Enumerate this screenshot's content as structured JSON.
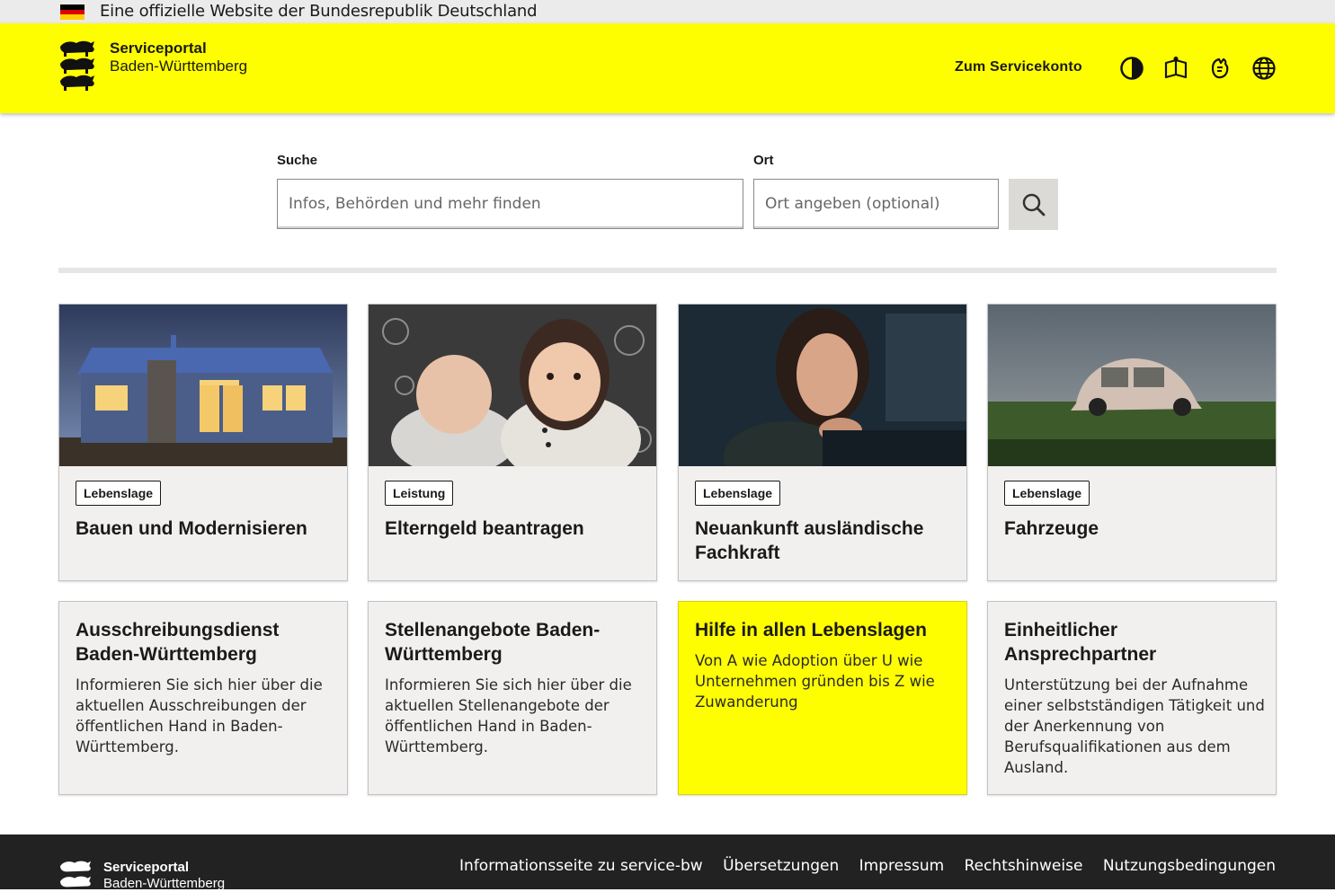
{
  "federal_bar": {
    "text": "Eine offizielle Website der Bundesrepublik Deutschland",
    "flag_colors": [
      "#000000",
      "#dd0000",
      "#ffce00"
    ]
  },
  "header": {
    "logo_line1": "Serviceportal",
    "logo_line2": "Baden-Württemberg",
    "account_link": "Zum Servicekonto",
    "icons": [
      "contrast-icon",
      "easy-language-icon",
      "sign-language-icon",
      "language-globe-icon"
    ],
    "background": "#fffe00"
  },
  "search": {
    "query_label": "Suche",
    "query_placeholder": "Infos, Behörden und mehr finden",
    "location_label": "Ort",
    "location_placeholder": "Ort angeben (optional)",
    "button_icon": "search-icon"
  },
  "cards": [
    {
      "tag": "Lebenslage",
      "title": "Bauen und Modernisieren"
    },
    {
      "tag": "Leistung",
      "title": "Elterngeld beantragen"
    },
    {
      "tag": "Lebenslage",
      "title": "Neuankunft ausländische Fachkraft"
    },
    {
      "tag": "Lebenslage",
      "title": "Fahrzeuge"
    }
  ],
  "info_cards": [
    {
      "title": "Ausschreibungsdienst Baden-Württemberg",
      "description": "Informieren Sie sich hier über die aktuellen Ausschreibungen der öffentlichen Hand in Baden-Württemberg."
    },
    {
      "title": "Stellenangebote Baden-Württemberg",
      "description": "Informieren Sie sich hier über die aktuellen Stellenangebote der öffentlichen Hand in Baden-Württemberg."
    },
    {
      "title": "Hilfe in allen Lebenslagen",
      "description": "Von A wie Adoption über U wie Unternehmen gründen bis Z wie Zuwanderung"
    },
    {
      "title": "Einheitlicher Ansprechpartner",
      "description": "Unterstützung bei der Aufnahme einer selbstständigen Tätigkeit und der Anerkennung von Berufsqualifikationen aus dem Ausland."
    }
  ],
  "footer": {
    "logo_line1": "Serviceportal",
    "logo_line2": "Baden-Württemberg",
    "links": [
      "Informationsseite zu service-bw",
      "Übersetzungen",
      "Impressum",
      "Rechtshinweise",
      "Nutzungsbedingungen"
    ]
  }
}
